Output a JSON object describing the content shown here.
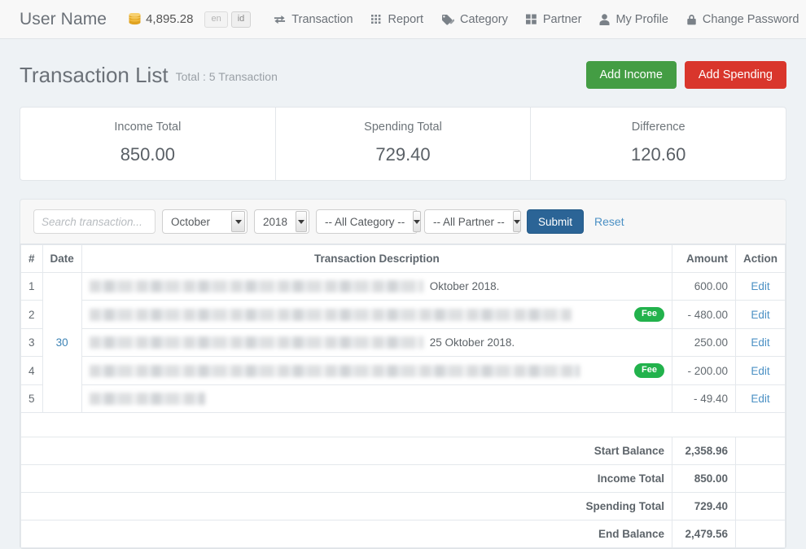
{
  "navbar": {
    "brand": "User Name",
    "balance": "4,895.28",
    "coin_icon": "coin-stack-icon",
    "languages": [
      {
        "code": "en",
        "active": false
      },
      {
        "code": "id",
        "active": true
      }
    ],
    "links": [
      {
        "label": "Transaction",
        "icon": "exchange-arrows-icon"
      },
      {
        "label": "Report",
        "icon": "grid-dots-icon"
      },
      {
        "label": "Category",
        "icon": "tag-icon"
      },
      {
        "label": "Partner",
        "icon": "squares-icon"
      },
      {
        "label": "My Profile",
        "icon": "user-icon"
      },
      {
        "label": "Change Password",
        "icon": "lock-icon"
      },
      {
        "label": "",
        "icon": "sign-out-icon"
      }
    ]
  },
  "header": {
    "title": "Transaction List",
    "subtitle": "Total : 5 Transaction",
    "add_income_label": "Add Income",
    "add_spending_label": "Add Spending",
    "add_income_color": "#449d44",
    "add_spending_color": "#d9362c"
  },
  "summary": [
    {
      "label": "Income Total",
      "value": "850.00"
    },
    {
      "label": "Spending Total",
      "value": "729.40"
    },
    {
      "label": "Difference",
      "value": "120.60"
    }
  ],
  "filters": {
    "search_placeholder": "Search transaction...",
    "search_value": "",
    "month": "October",
    "year": "2018",
    "category": "-- All Category --",
    "partner": "-- All Partner --",
    "submit_label": "Submit",
    "reset_label": "Reset"
  },
  "table": {
    "headers": {
      "num": "#",
      "date": "Date",
      "description": "Transaction Description",
      "amount": "Amount",
      "action": "Action"
    },
    "rows": [
      {
        "num": "1",
        "date": "",
        "redact_width": 410,
        "visible_text": "Oktober 2018.",
        "badge": "",
        "amount": "600.00",
        "action": "Edit"
      },
      {
        "num": "2",
        "date": "",
        "redact_width": 592,
        "visible_text": "",
        "badge": "Fee",
        "amount": "- 480.00",
        "action": "Edit"
      },
      {
        "num": "3",
        "date": "30",
        "redact_width": 410,
        "visible_text": "25 Oktober 2018.",
        "badge": "",
        "amount": "250.00",
        "action": "Edit"
      },
      {
        "num": "4",
        "date": "",
        "redact_width": 602,
        "visible_text": "",
        "badge": "Fee",
        "amount": "- 200.00",
        "action": "Edit"
      },
      {
        "num": "5",
        "date": "",
        "redact_width": 142,
        "visible_text": "",
        "badge": "",
        "amount": "- 49.40",
        "action": "Edit"
      }
    ],
    "footer": [
      {
        "label": "Start Balance",
        "value": "2,358.96"
      },
      {
        "label": "Income Total",
        "value": "850.00"
      },
      {
        "label": "Spending Total",
        "value": "729.40"
      },
      {
        "label": "End Balance",
        "value": "2,479.56"
      }
    ]
  },
  "colors": {
    "page_bg": "#eef2f5",
    "navbar_bg": "#f8f8f8",
    "link_blue": "#4b90c4",
    "submit_blue": "#2b6496",
    "fee_green": "#22b24c"
  }
}
